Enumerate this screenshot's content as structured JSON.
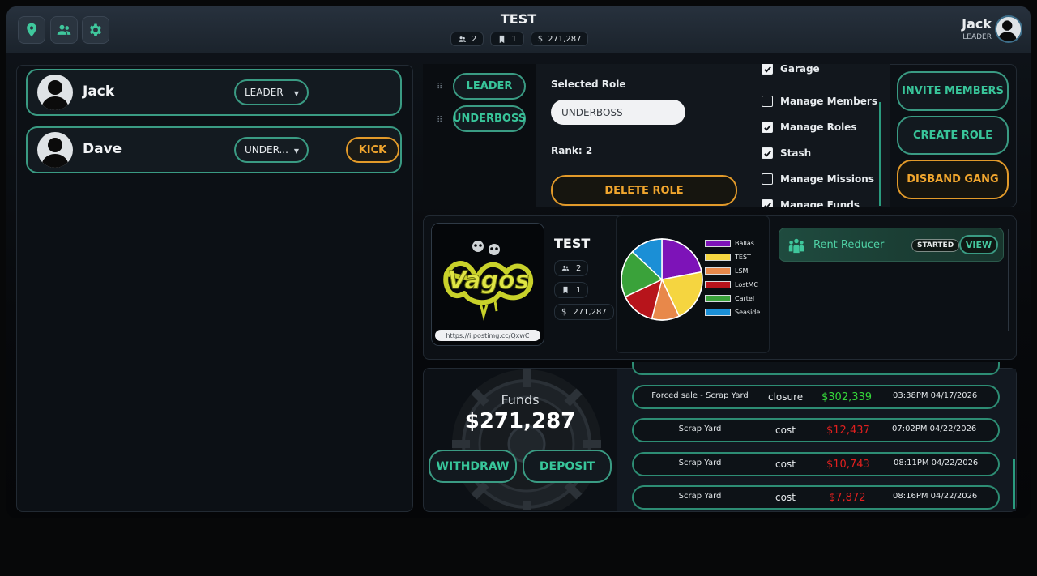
{
  "header": {
    "gang_name": "TEST",
    "members_count": "2",
    "ranks_count": "1",
    "funds_total": "271,287",
    "nav_icons": [
      "location-pin-icon",
      "members-icon",
      "gear-icon"
    ],
    "user_name": "Jack",
    "user_role": "LEADER"
  },
  "members": [
    {
      "name": "Jack",
      "role": "LEADER"
    },
    {
      "name": "Dave",
      "role": "UNDER...",
      "action": "KICK"
    }
  ],
  "roles": {
    "list": [
      "LEADER",
      "UNDERBOSS"
    ],
    "selected_role_label": "Selected Role",
    "selected_role_value": "UNDERBOSS",
    "rank_text": "Rank: 2",
    "delete_label": "DELETE ROLE",
    "permissions": [
      {
        "label": "Garage",
        "checked": true
      },
      {
        "label": "Manage Members",
        "checked": false
      },
      {
        "label": "Manage Roles",
        "checked": true
      },
      {
        "label": "Stash",
        "checked": true
      },
      {
        "label": "Manage Missions",
        "checked": false
      },
      {
        "label": "Manage Funds",
        "checked": true
      }
    ]
  },
  "actions": {
    "invite": "INVITE MEMBERS",
    "create_role": "CREATE ROLE",
    "disband": "DISBAND GANG"
  },
  "gang_info": {
    "name": "TEST",
    "members": "2",
    "ranks": "1",
    "funds": "271,287",
    "logo_url": "https://i.postimg.cc/QxwC",
    "logo_text": "Vagos"
  },
  "chart_data": {
    "type": "pie",
    "title": "",
    "categories": [
      "Ballas",
      "TEST",
      "LSM",
      "LostMC",
      "Cartel",
      "Seaside"
    ],
    "values": [
      22,
      21,
      11,
      14,
      19,
      13
    ],
    "colors": [
      "#7d13b8",
      "#f5d540",
      "#e8884a",
      "#b7141b",
      "#3aa23a",
      "#1b8fd6"
    ],
    "legend_position": "right"
  },
  "mission": {
    "title": "Rent Reducer",
    "status": "STARTED",
    "view_label": "VIEW",
    "icon": "group-icon"
  },
  "funds": {
    "title": "Funds",
    "amount": "$271,287",
    "withdraw_label": "WITHDRAW",
    "deposit_label": "DEPOSIT"
  },
  "transactions": [
    {
      "label": "Forced sale - Scrap Yard",
      "type": "closure",
      "amount": "$302,339",
      "time": "03:38PM 04/17/2026",
      "positive": true
    },
    {
      "label": "Scrap Yard",
      "type": "cost",
      "amount": "$12,437",
      "time": "07:02PM 04/22/2026",
      "positive": false
    },
    {
      "label": "Scrap Yard",
      "type": "cost",
      "amount": "$10,743",
      "time": "08:11PM 04/22/2026",
      "positive": false
    },
    {
      "label": "Scrap Yard",
      "type": "cost",
      "amount": "$7,872",
      "time": "08:16PM 04/22/2026",
      "positive": false
    }
  ],
  "colors": {
    "accent": "#3a9b83",
    "accent_text": "#38c59a",
    "warning": "#f1a62e",
    "positive": "#35d63a",
    "negative": "#e0201f"
  }
}
